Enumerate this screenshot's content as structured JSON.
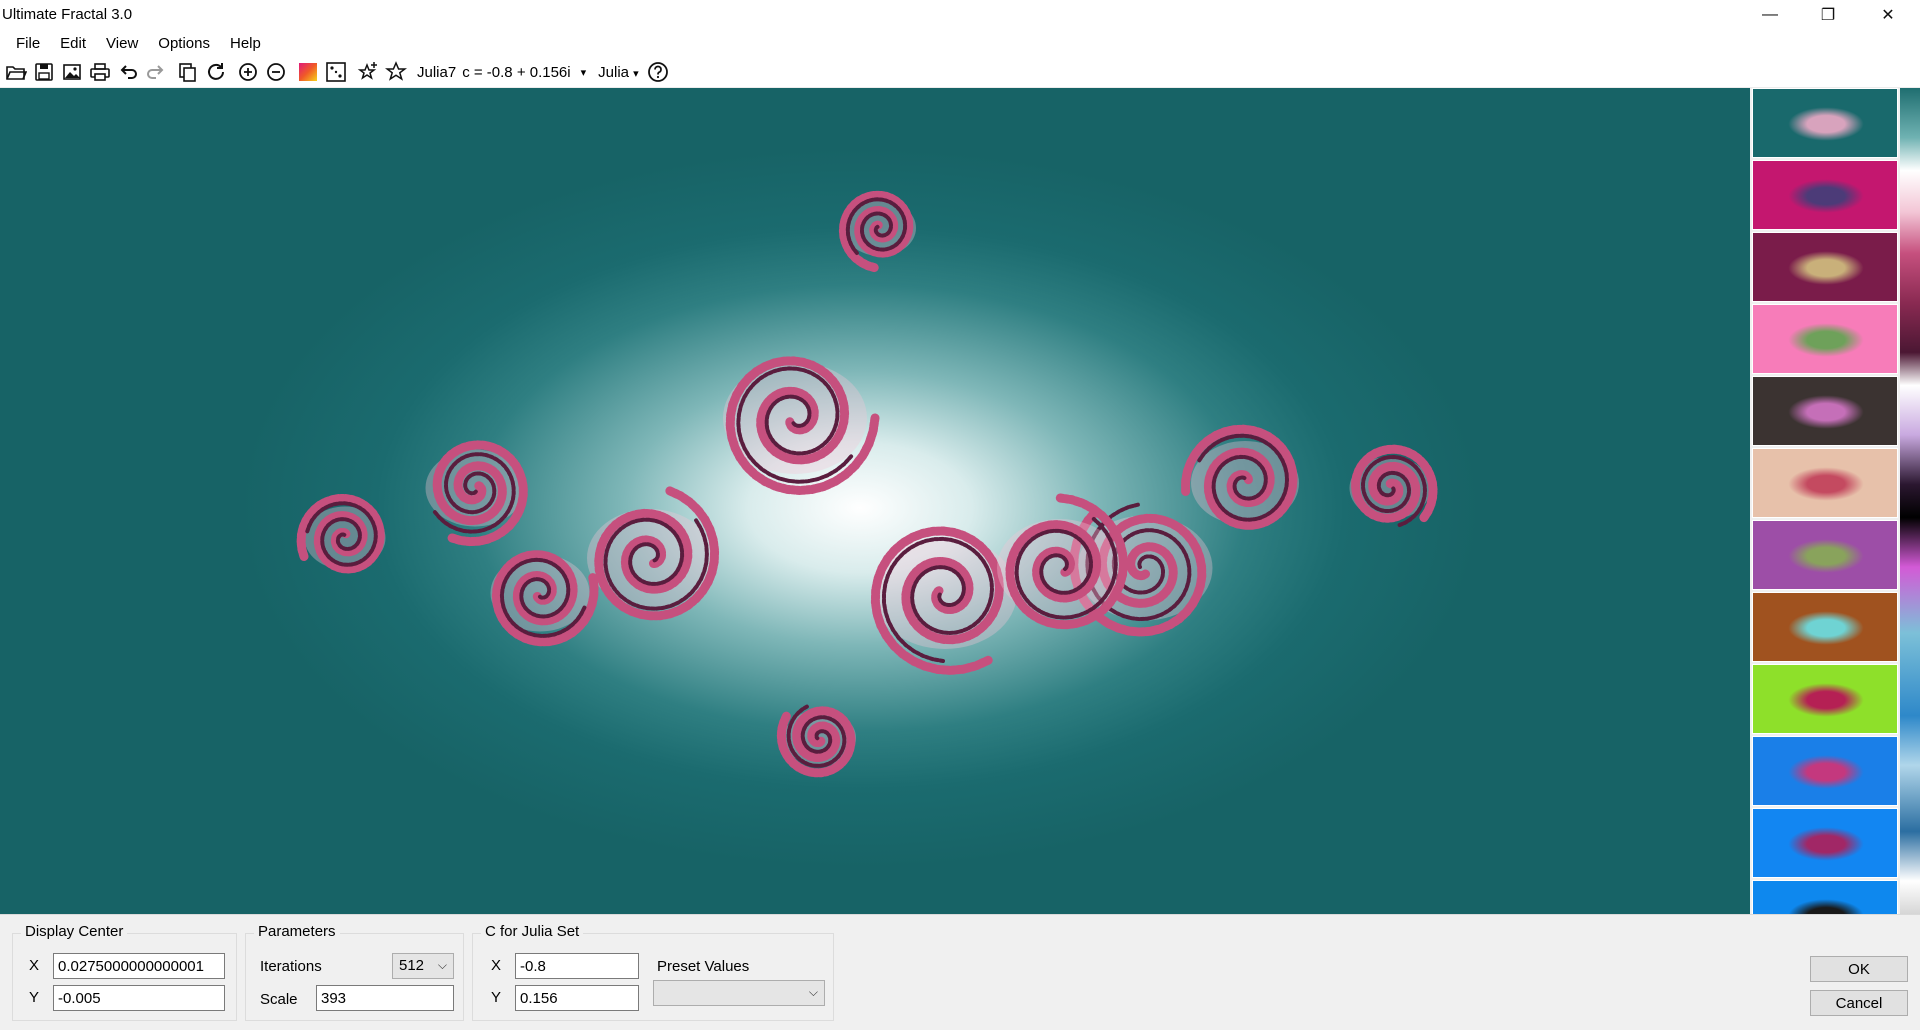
{
  "window": {
    "title": "Ultimate Fractal 3.0",
    "minimize_glyph": "—",
    "restore_glyph": "❐",
    "close_glyph": "✕"
  },
  "menu": [
    "File",
    "Edit",
    "View",
    "Options",
    "Help"
  ],
  "toolbar": {
    "icons": [
      "open-icon",
      "save-icon",
      "image-icon",
      "print-icon",
      "undo-icon",
      "redo-icon",
      "copy-icon",
      "refresh-icon",
      "zoom-in-icon",
      "zoom-out-icon",
      "color-palette-icon",
      "random-icon",
      "add-favorite-icon",
      "favorite-icon"
    ],
    "fractal_name": "Julia7",
    "formula": "c = -0.8 + 0.156i",
    "dropdown_glyph": "▾",
    "family": "Julia",
    "help_icon": "help-icon"
  },
  "colors": {
    "canvas_bg": "#1b6b6f",
    "fractal_pink": "#c6507e",
    "fractal_dark": "#5a1d3e",
    "fractal_light": "#f4c6d8"
  },
  "thumbnails": [
    {
      "bg": "#19696c",
      "fg": "#d8a3bd"
    },
    {
      "bg": "#c4176f",
      "fg": "#4c3b78"
    },
    {
      "bg": "#7a1c4a",
      "fg": "#c9b07a"
    },
    {
      "bg": "#f77cb9",
      "fg": "#6ea15a"
    },
    {
      "bg": "#3b3331",
      "fg": "#c56fb8"
    },
    {
      "bg": "#e7c1aa",
      "fg": "#c44a60"
    },
    {
      "bg": "#9d4ea7",
      "fg": "#89a35c"
    },
    {
      "bg": "#a0521f",
      "fg": "#6fd3d3"
    },
    {
      "bg": "#8ee02a",
      "fg": "#b52054"
    },
    {
      "bg": "#1a7fe8",
      "fg": "#c4387e"
    },
    {
      "bg": "#1286f2",
      "fg": "#a12766"
    },
    {
      "bg": "#0e88ee",
      "fg": "#1a1a1a"
    }
  ],
  "display_center": {
    "title": "Display Center",
    "x_label": "X",
    "x_value": "0.0275000000000001",
    "y_label": "Y",
    "y_value": "-0.005"
  },
  "parameters": {
    "title": "Parameters",
    "iterations_label": "Iterations",
    "iterations_value": "512",
    "scale_label": "Scale",
    "scale_value": "393"
  },
  "julia_c": {
    "title": "C for Julia Set",
    "x_label": "X",
    "x_value": "-0.8",
    "y_label": "Y",
    "y_value": "0.156",
    "preset_label": "Preset Values",
    "preset_value": ""
  },
  "buttons": {
    "ok": "OK",
    "cancel": "Cancel"
  }
}
